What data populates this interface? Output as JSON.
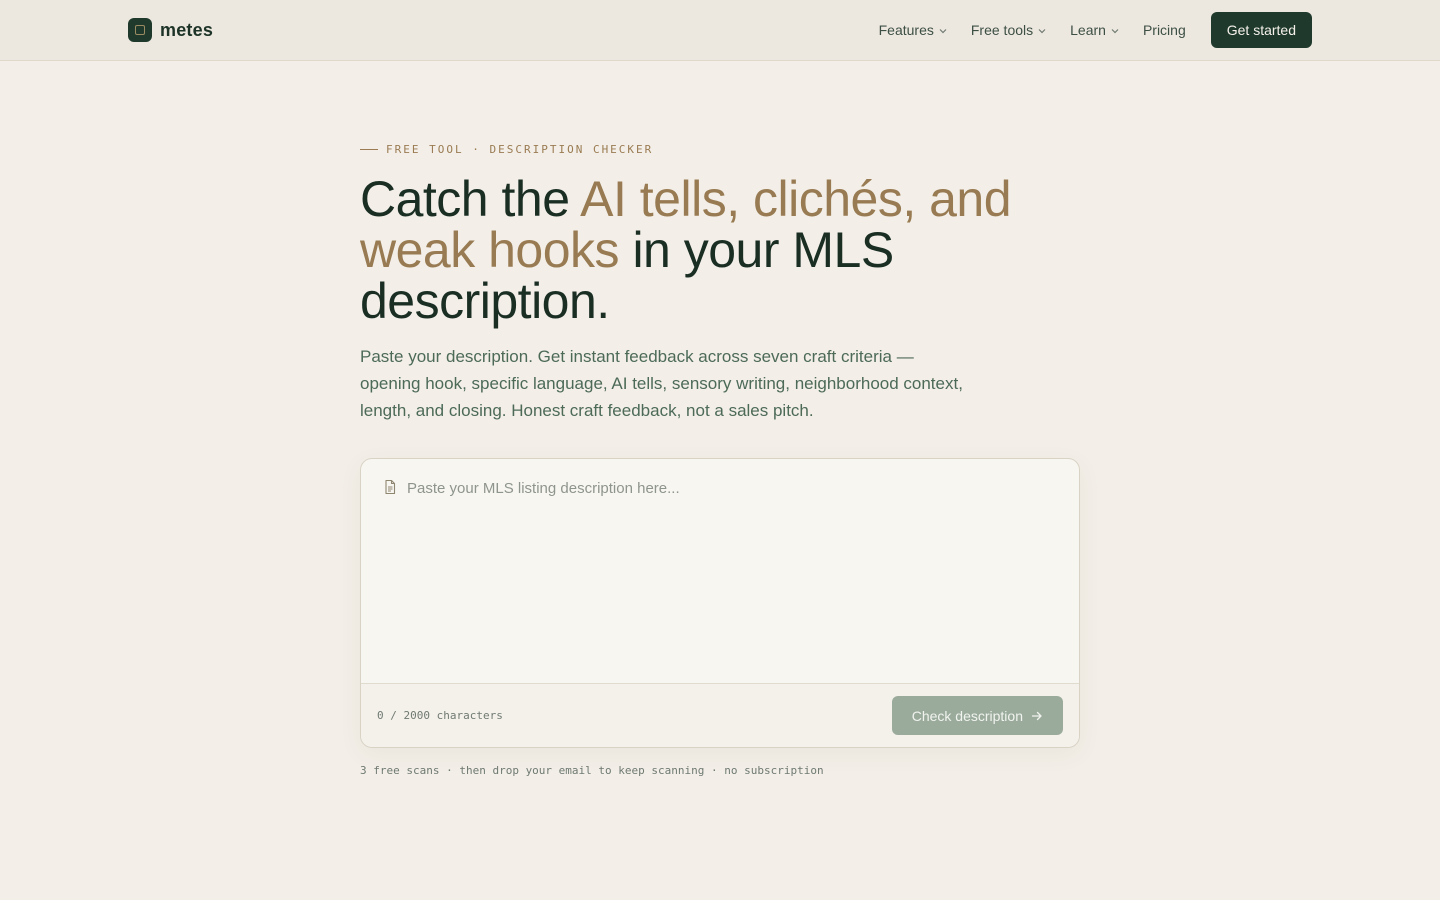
{
  "header": {
    "brand": "metes",
    "nav": [
      {
        "label": "Features",
        "has_dropdown": true
      },
      {
        "label": "Free tools",
        "has_dropdown": true
      },
      {
        "label": "Learn",
        "has_dropdown": true
      },
      {
        "label": "Pricing",
        "has_dropdown": false
      }
    ],
    "cta_label": "Get started"
  },
  "hero": {
    "eyebrow": "FREE TOOL · DESCRIPTION CHECKER",
    "headline_part1": "Catch the ",
    "headline_accent": "AI tells, clichés, and weak hooks",
    "headline_part2": " in your MLS description.",
    "subhead": "Paste your description. Get instant feedback across seven craft criteria — opening hook, specific language, AI tells, sensory writing, neighborhood context, length, and closing. Honest craft feedback, not a sales pitch."
  },
  "editor": {
    "placeholder": "Paste your MLS listing description here...",
    "value": "",
    "counter": "0 / 2000 characters",
    "submit_label": "Check description"
  },
  "footnote": "3 free scans · then drop your email to keep scanning · no subscription",
  "colors": {
    "brand_dark": "#1f3a2c",
    "accent": "#987b52",
    "background": "#f3efe8",
    "button_disabled": "#9aab9c"
  },
  "icons": {
    "brand": "brand-logo-icon",
    "dropdown": "chevron-down-icon",
    "document": "document-icon",
    "arrow": "arrow-right-icon"
  }
}
